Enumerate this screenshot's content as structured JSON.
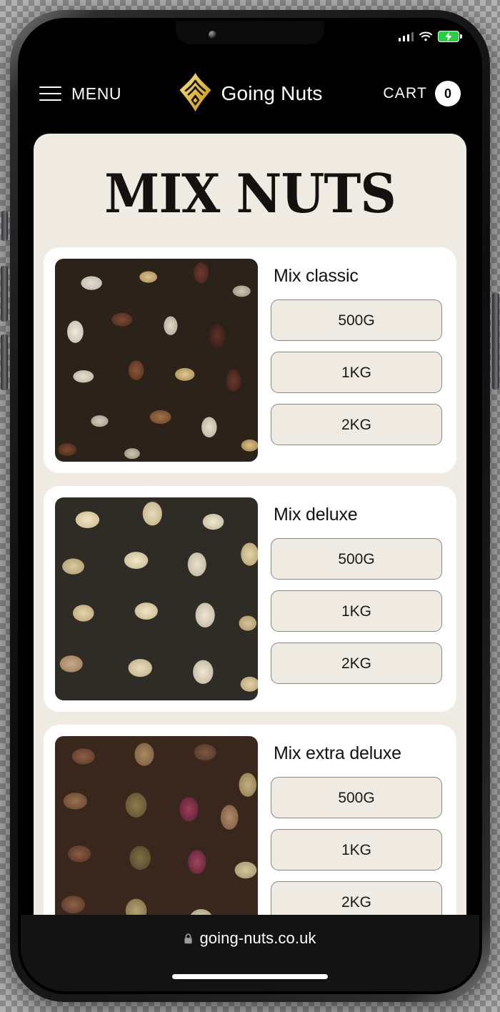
{
  "device": {
    "statusbar": {
      "signal_icon": "cellular-signal-icon",
      "signal_bars": 4,
      "signal_active_bars": 3,
      "wifi_icon": "wifi-icon",
      "battery_icon": "battery-charging-icon",
      "battery_charging": true,
      "battery_color": "#28cd41"
    },
    "notch_camera_icon": "front-camera-icon",
    "speaker_icon": "earpiece-speaker-icon",
    "buttons": {
      "silent_switch": "silent-switch",
      "volume_up": "volume-up-button",
      "volume_down": "volume-down-button",
      "power": "power-button"
    },
    "home_indicator": "home-indicator"
  },
  "header": {
    "menu_icon": "hamburger-menu-icon",
    "menu_label": "MENU",
    "logo_icon": "going-nuts-diamond-logo",
    "logo_color": "#e8c563",
    "brand_name": "Going Nuts",
    "cart_label": "CART",
    "cart_count": "0"
  },
  "page": {
    "title": "MIX NUTS",
    "background_color": "#efeae2",
    "card_background": "#ffffff",
    "products": [
      {
        "name": "Mix classic",
        "image_alt": "mixed-nuts-classic-photo",
        "sizes": [
          "500G",
          "1KG",
          "2KG"
        ]
      },
      {
        "name": "Mix deluxe",
        "image_alt": "mixed-nuts-deluxe-photo",
        "sizes": [
          "500G",
          "1KG",
          "2KG"
        ]
      },
      {
        "name": "Mix extra deluxe",
        "image_alt": "mixed-nuts-extra-deluxe-photo",
        "sizes": [
          "500G",
          "1KG",
          "2KG"
        ]
      }
    ]
  },
  "browser": {
    "lock_icon": "lock-icon",
    "url": "going-nuts.co.uk"
  }
}
